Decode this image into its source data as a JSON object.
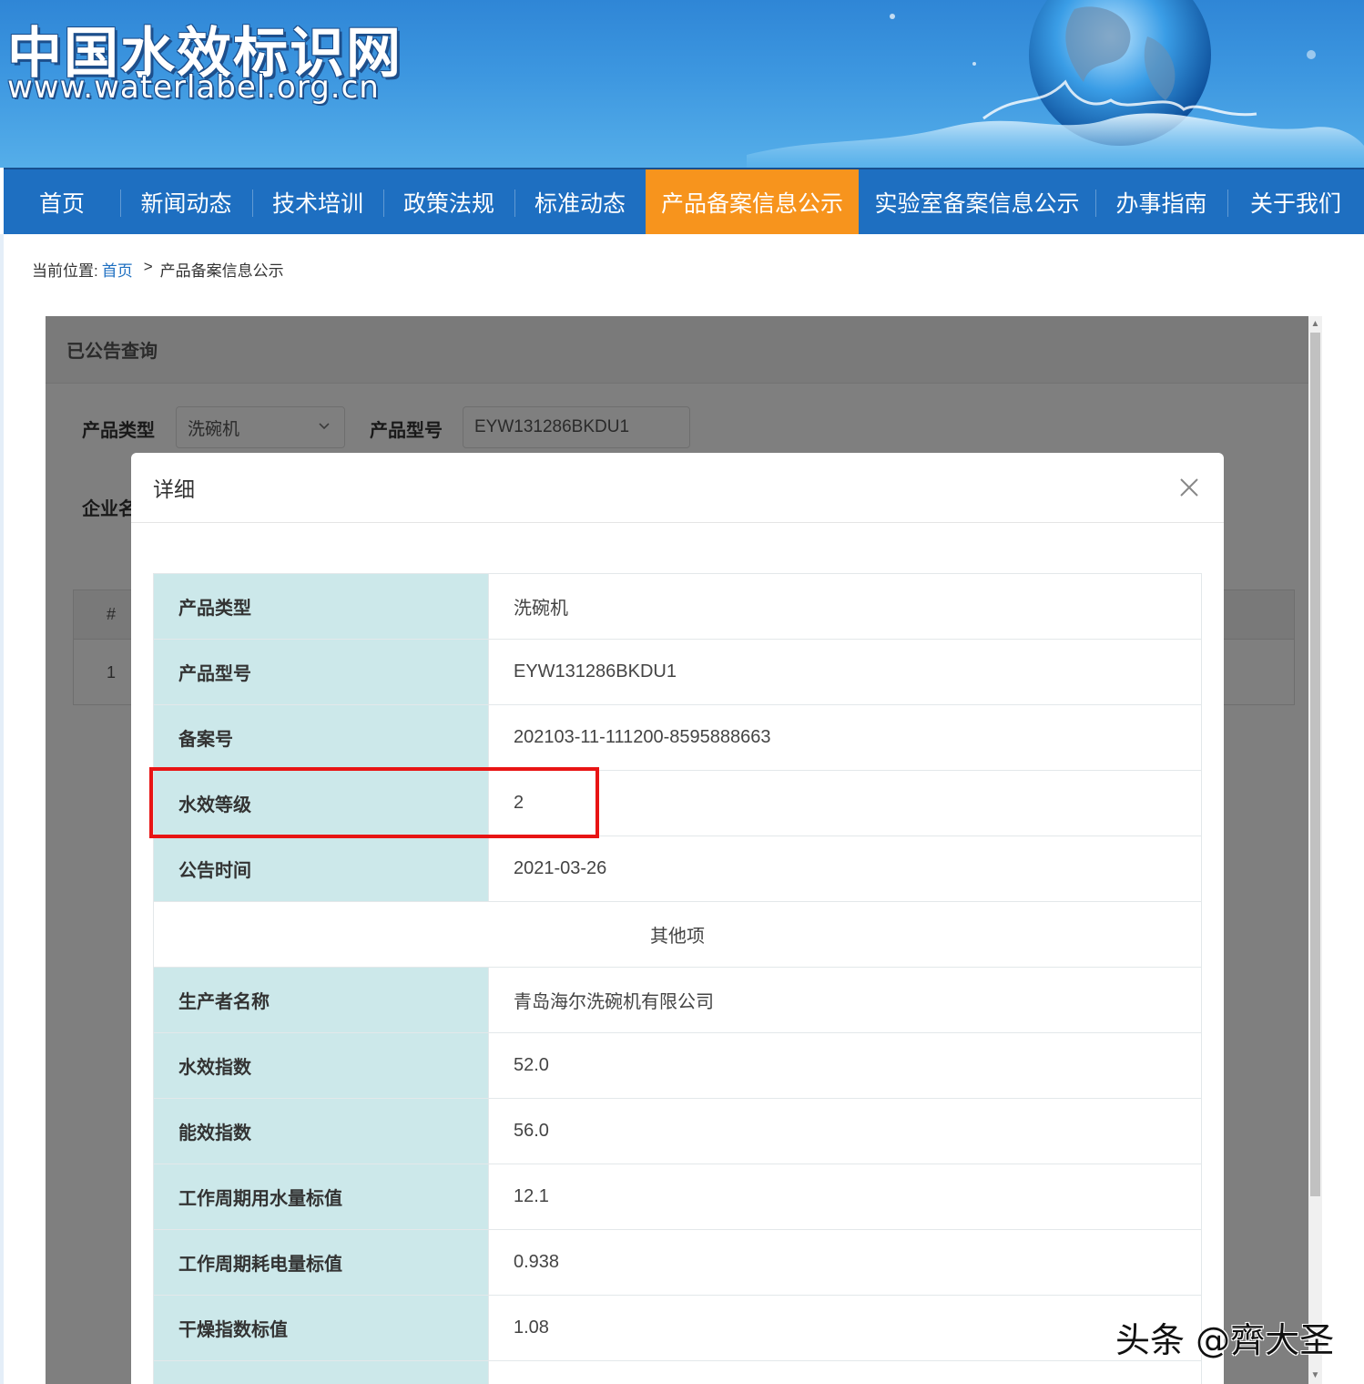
{
  "header": {
    "site_name": "中国水效标识网",
    "site_url": "www.waterlabel.org.cn"
  },
  "nav": {
    "items": [
      {
        "label": "首页",
        "active": false
      },
      {
        "label": "新闻动态",
        "active": false
      },
      {
        "label": "技术培训",
        "active": false
      },
      {
        "label": "政策法规",
        "active": false
      },
      {
        "label": "标准动态",
        "active": false
      },
      {
        "label": "产品备案信息公示",
        "active": true
      },
      {
        "label": "实验室备案信息公示",
        "active": false
      },
      {
        "label": "办事指南",
        "active": false
      },
      {
        "label": "关于我们",
        "active": false
      }
    ]
  },
  "breadcrumb": {
    "prefix": "当前位置:",
    "home": "首页",
    "separator": ">",
    "current": "产品备案信息公示"
  },
  "panel": {
    "title": "已公告查询",
    "product_type_label": "产品类型",
    "product_type_value": "洗碗机",
    "product_model_label": "产品型号",
    "product_model_value": "EYW131286BKDU1",
    "company_label_partial": "企业名",
    "table_header_index": "#",
    "table_row_index": "1"
  },
  "modal": {
    "title": "详细",
    "rows": [
      {
        "key": "产品类型",
        "value": "洗碗机"
      },
      {
        "key": "产品型号",
        "value": "EYW131286BKDU1"
      },
      {
        "key": "备案号",
        "value": "202103-11-111200-8595888663"
      },
      {
        "key": "水效等级",
        "value": "2"
      },
      {
        "key": "公告时间",
        "value": "2021-03-26"
      }
    ],
    "section_label": "其他项",
    "other_rows": [
      {
        "key": "生产者名称",
        "value": "青岛海尔洗碗机有限公司"
      },
      {
        "key": "水效指数",
        "value": "52.0"
      },
      {
        "key": "能效指数",
        "value": "56.0"
      },
      {
        "key": "工作周期用水量标值",
        "value": "12.1"
      },
      {
        "key": "工作周期耗电量标值",
        "value": "0.938"
      },
      {
        "key": "干燥指数标值",
        "value": "1.08"
      }
    ]
  },
  "watermark": "头条 @齊大圣",
  "colors": {
    "nav_bg": "#1e6fc1",
    "nav_active": "#f7941d",
    "key_cell_bg": "#cce8ea",
    "highlight": "#e81414"
  }
}
